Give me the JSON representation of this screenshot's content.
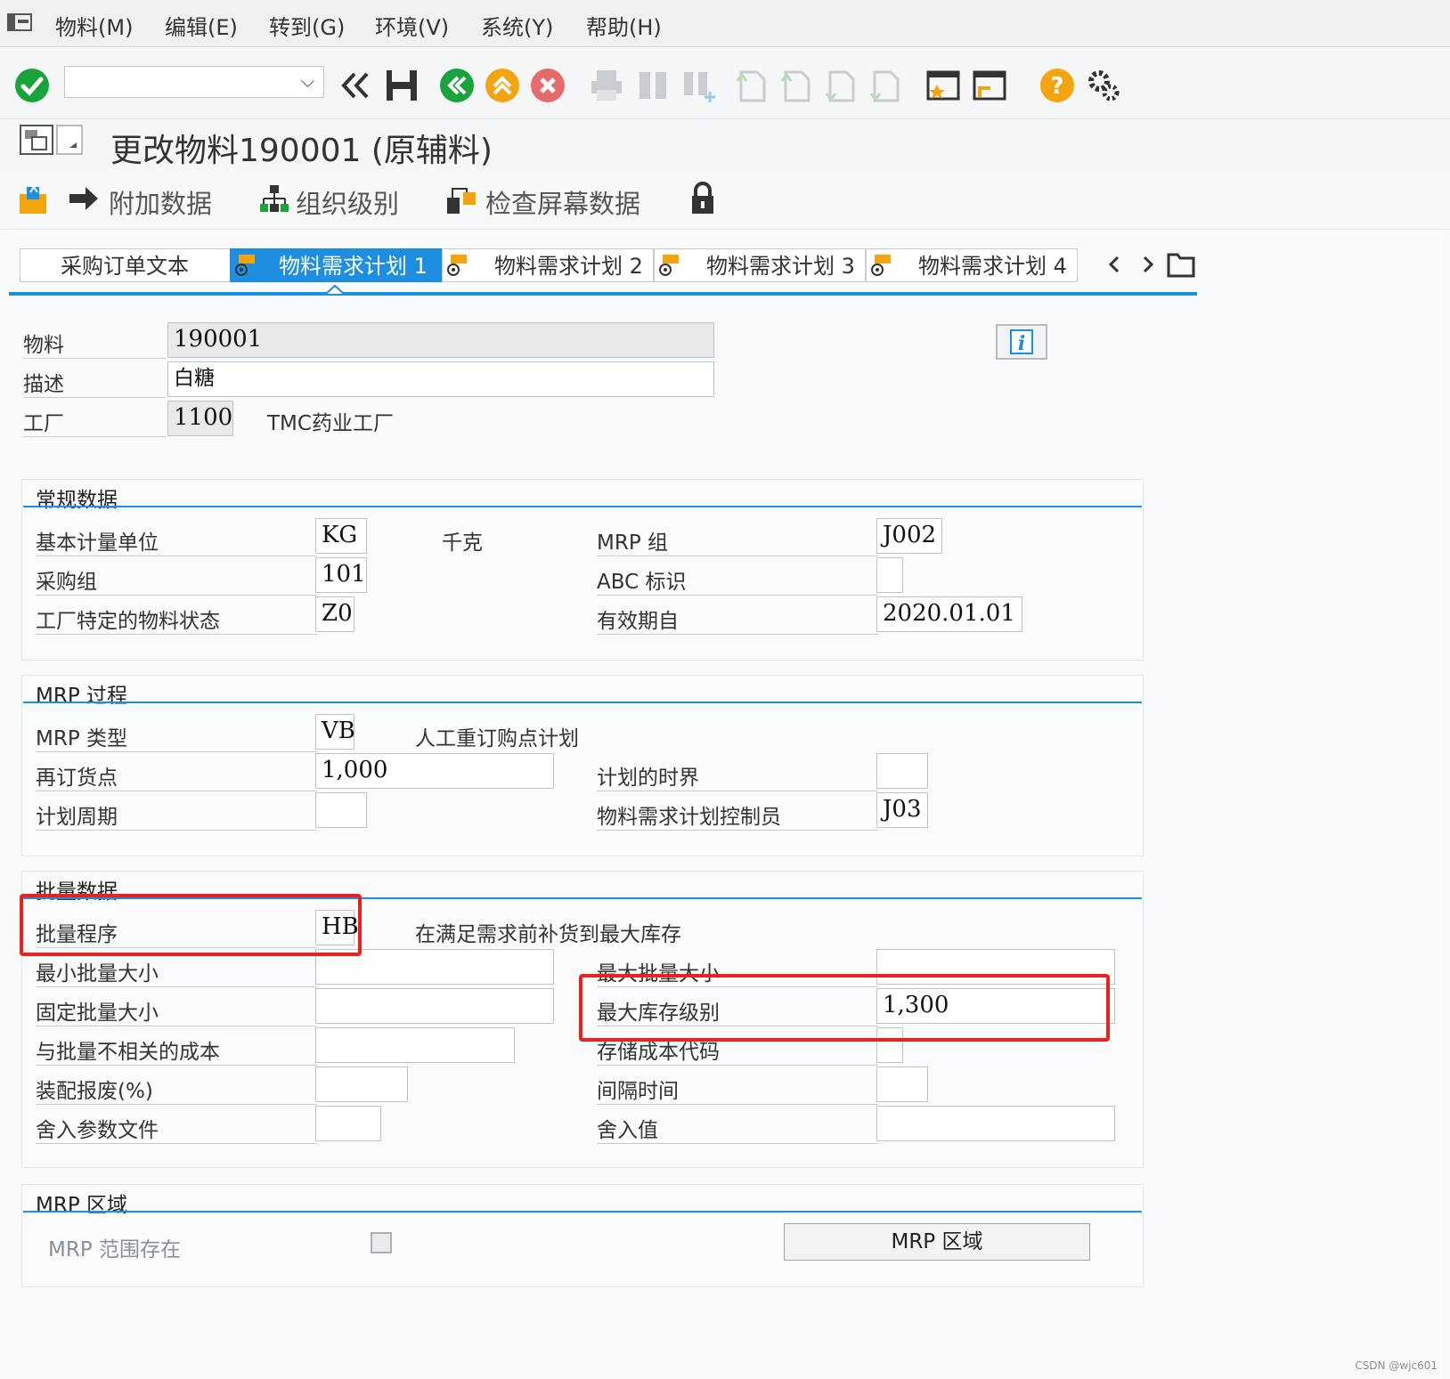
{
  "menu": [
    "物料(M)",
    "编辑(E)",
    "转到(G)",
    "环境(V)",
    "系统(Y)",
    "帮助(H)"
  ],
  "title": "更改物料190001 (原辅料)",
  "app_toolbar": {
    "additional_data": "附加数据",
    "org_levels": "组织级别",
    "check_screen_data": "检查屏幕数据"
  },
  "tabs": [
    "采购订单文本",
    "物料需求计划 1",
    "物料需求计划 2",
    "物料需求计划 3",
    "物料需求计划 4"
  ],
  "header": {
    "material_label": "物料",
    "material_value": "190001",
    "description_label": "描述",
    "description_value": "白糖",
    "plant_label": "工厂",
    "plant_value": "1100",
    "plant_name": "TMC药业工厂"
  },
  "general": {
    "title": "常规数据",
    "base_uom_label": "基本计量单位",
    "base_uom_value": "KG",
    "base_uom_text": "千克",
    "mrp_group_label": "MRP 组",
    "mrp_group_value": "J002",
    "purch_group_label": "采购组",
    "purch_group_value": "101",
    "abc_label": "ABC 标识",
    "abc_value": "",
    "plant_status_label": "工厂特定的物料状态",
    "plant_status_value": "Z0",
    "valid_from_label": "有效期自",
    "valid_from_value": "2020.01.01"
  },
  "mrp_proc": {
    "title": "MRP 过程",
    "mrp_type_label": "MRP 类型",
    "mrp_type_value": "VB",
    "mrp_type_text": "人工重订购点计划",
    "reorder_label": "再订货点",
    "reorder_value": "1,000",
    "time_fence_label": "计划的时界",
    "time_fence_value": "",
    "cycle_label": "计划周期",
    "cycle_value": "",
    "controller_label": "物料需求计划控制员",
    "controller_value": "J03"
  },
  "lot": {
    "title": "批量数据",
    "procedure_label": "批量程序",
    "procedure_value": "HB",
    "procedure_text": "在满足需求前补货到最大库存",
    "min_label": "最小批量大小",
    "min_value": "",
    "max_label": "最大批量大小",
    "max_value": "",
    "fixed_label": "固定批量大小",
    "fixed_value": "",
    "max_stock_label": "最大库存级别",
    "max_stock_value": "1,300",
    "cost_label": "与批量不相关的成本",
    "cost_value": "",
    "storage_cost_label": "存储成本代码",
    "storage_cost_value": "",
    "scrap_label": "装配报废(%)",
    "scrap_value": "",
    "takt_label": "间隔时间",
    "takt_value": "",
    "rounding_profile_label": "舍入参数文件",
    "rounding_profile_value": "",
    "rounding_value_label": "舍入值",
    "rounding_value_value": ""
  },
  "mrp_area": {
    "title": "MRP 区域",
    "exists_label": "MRP  范围存在",
    "button": "MRP 区域"
  },
  "watermark": "CSDN @wjc601",
  "colors": {
    "accent": "#1d8ee0",
    "highlight": "#e8231e",
    "ok": "#1aa33b",
    "nav_green": "#1aa33b",
    "nav_orange": "#f3a40e",
    "cancel_red": "#e86b6b"
  }
}
